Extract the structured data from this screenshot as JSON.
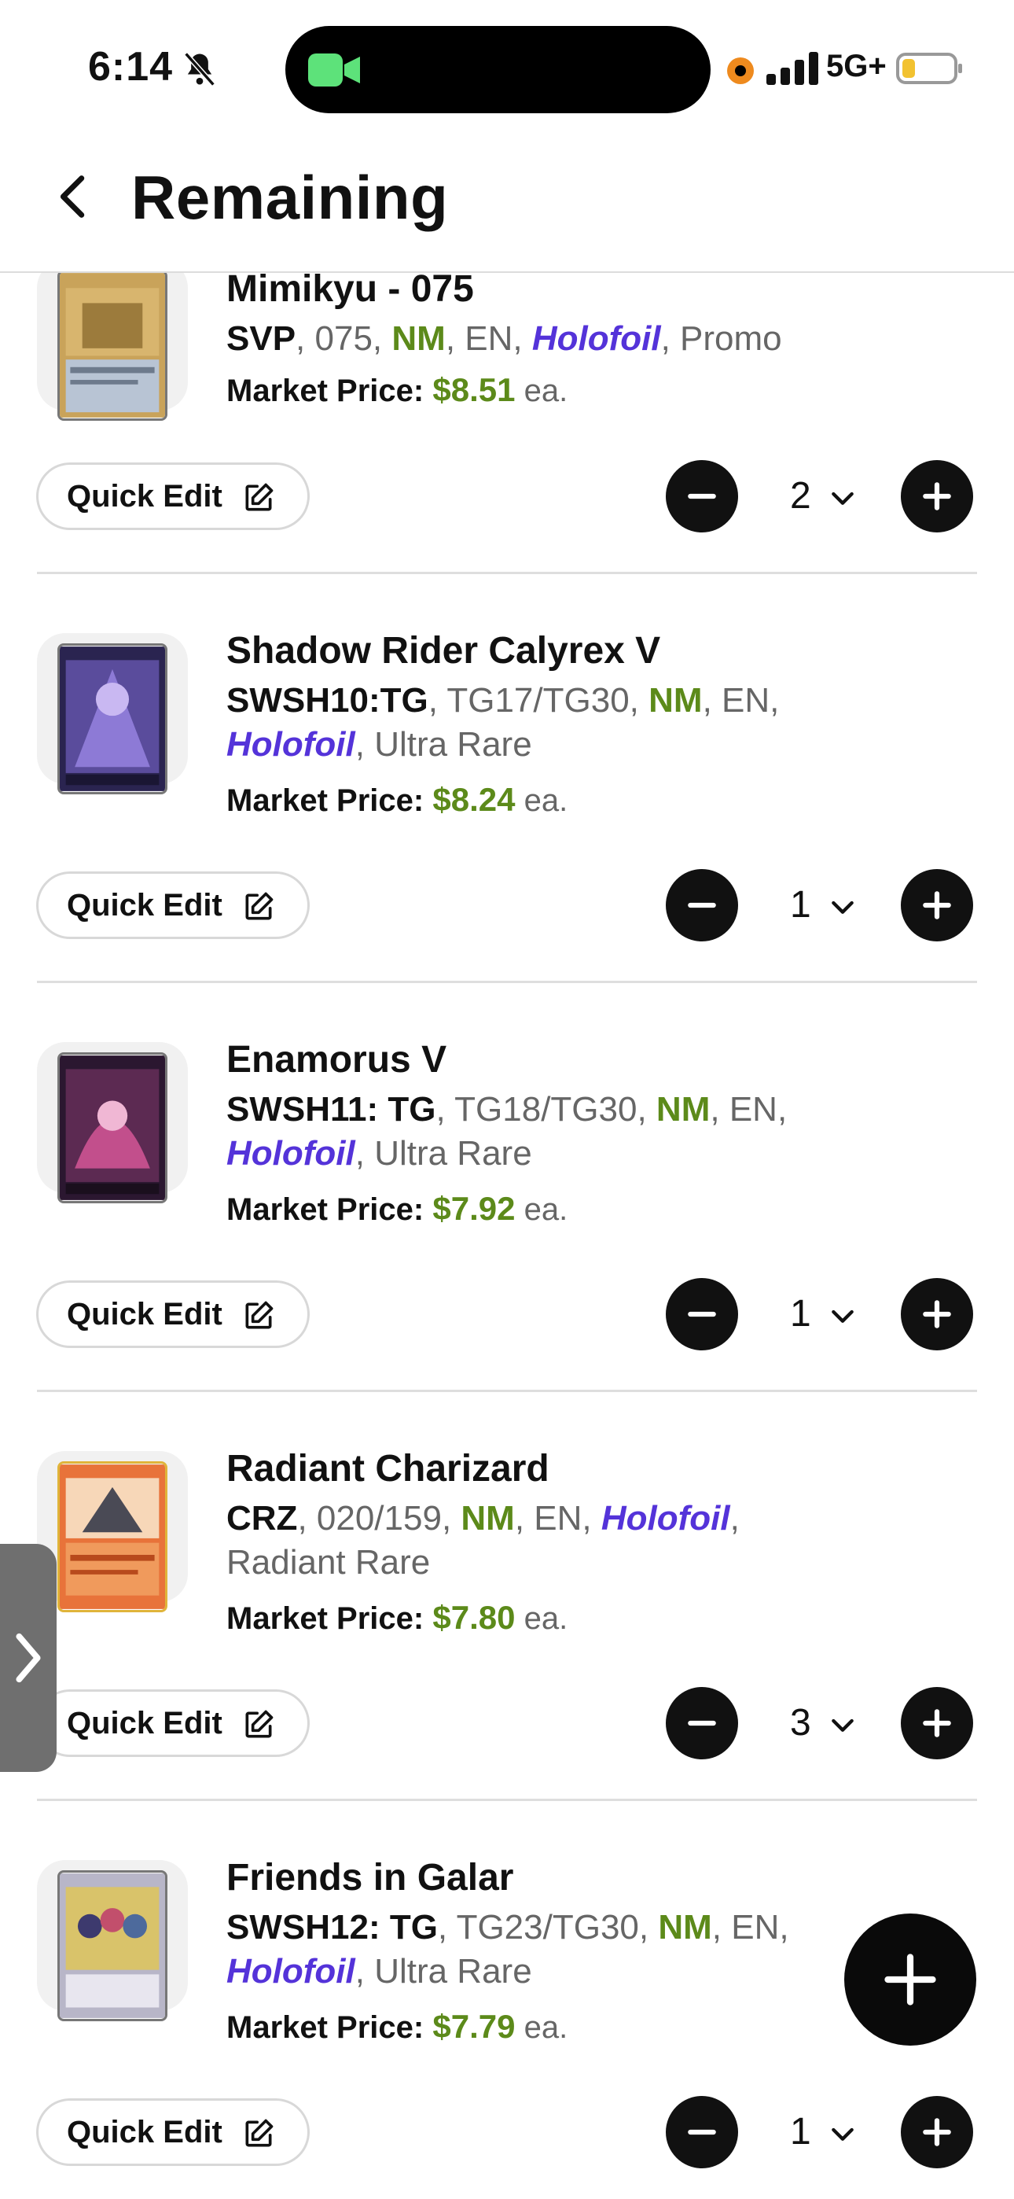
{
  "status_bar": {
    "time": "6:14",
    "network": "5G+"
  },
  "header": {
    "title": "Remaining"
  },
  "labels": {
    "quick_edit": "Quick Edit",
    "market_price": "Market Price:",
    "each": "ea."
  },
  "items": [
    {
      "name": "Mimikyu - 075",
      "set": "SVP",
      "number": "075",
      "condition": "NM",
      "language": "EN",
      "finish": "Holofoil",
      "rarity": "Promo",
      "price": "$8.51",
      "quantity": "2"
    },
    {
      "name": "Shadow Rider Calyrex V",
      "set": "SWSH10:TG",
      "number": "TG17/TG30",
      "condition": "NM",
      "language": "EN",
      "finish": "Holofoil",
      "rarity": "Ultra Rare",
      "price": "$8.24",
      "quantity": "1"
    },
    {
      "name": "Enamorus V",
      "set": "SWSH11: TG",
      "number": "TG18/TG30",
      "condition": "NM",
      "language": "EN",
      "finish": "Holofoil",
      "rarity": "Ultra Rare",
      "price": "$7.92",
      "quantity": "1"
    },
    {
      "name": "Radiant Charizard",
      "set": "CRZ",
      "number": "020/159",
      "condition": "NM",
      "language": "EN",
      "finish": "Holofoil",
      "rarity": "Radiant Rare",
      "price": "$7.80",
      "quantity": "3"
    },
    {
      "name": "Friends in Galar",
      "set": "SWSH12: TG",
      "number": "TG23/TG30",
      "condition": "NM",
      "language": "EN",
      "finish": "Holofoil",
      "rarity": "Ultra Rare",
      "price": "$7.79",
      "quantity": "1"
    }
  ],
  "colors": {
    "condition": "#5c8a1a",
    "finish": "#5433d9",
    "price": "#5c8a1a",
    "button": "#111111"
  },
  "icons": [
    "bell-slash-icon",
    "video-camera-icon",
    "signal-icon",
    "battery-icon",
    "chevron-left-icon",
    "edit-icon",
    "minus-icon",
    "plus-icon",
    "chevron-down-icon",
    "chevron-right-icon"
  ]
}
